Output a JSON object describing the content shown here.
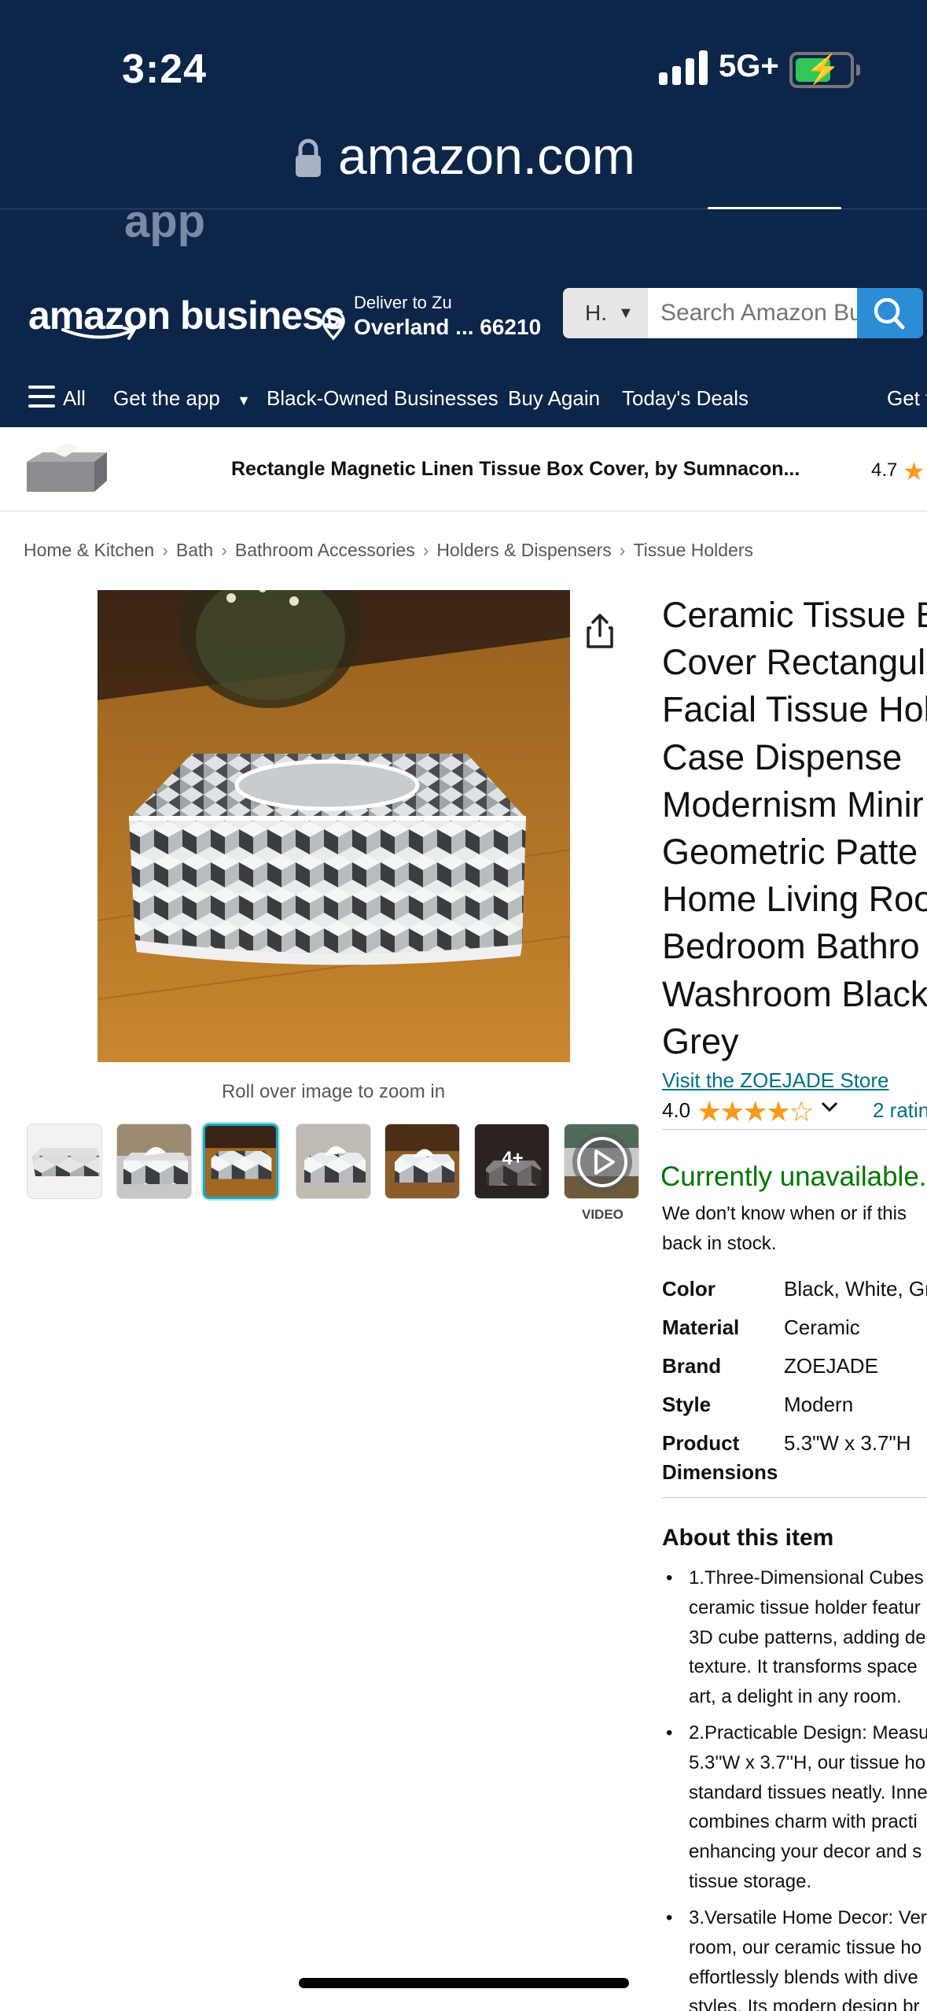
{
  "status_bar": {
    "time": "3:24",
    "network": "5G+"
  },
  "browser": {
    "url": "amazon.com",
    "banner_text": "app"
  },
  "header": {
    "logo": "amazon business",
    "deliver_line1": "Deliver to Zu",
    "deliver_line2": "Overland ... 66210",
    "search": {
      "department": "H.",
      "placeholder": "Search Amazon Business"
    }
  },
  "nav": {
    "items": [
      "All",
      "Get the app",
      "Black-Owned Businesses",
      "Buy Again",
      "Today's Deals",
      "Get f"
    ]
  },
  "sticky_bar": {
    "title": "Rectangle Magnetic Linen Tissue Box Cover, by Sumnacon...",
    "rating": "4.7"
  },
  "breadcrumb": [
    "Home & Kitchen",
    "Bath",
    "Bathroom Accessories",
    "Holders & Dispensers",
    "Tissue Holders"
  ],
  "gallery": {
    "zoom_hint": "Roll over image to zoom in",
    "more_label": "4+",
    "video_label": "VIDEO"
  },
  "product": {
    "title_lines": [
      "Ceramic Tissue B",
      "Cover Rectangula",
      "Facial Tissue Hol",
      "Case Dispense",
      "Modernism Minir",
      "Geometric Patte",
      "Home Living Roo",
      "Bedroom Bathro",
      "Washroom Black",
      "Grey"
    ],
    "store_link": "Visit the ZOEJADE Store",
    "rating": "4.0",
    "rating_value": 4.0,
    "rating_count": "2 ratin",
    "availability": "Currently unavailable.",
    "availability_desc": "We don't know when or if this back in stock.",
    "specs": [
      {
        "key": "Color",
        "value": "Black, White, Gr"
      },
      {
        "key": "Material",
        "value": "Ceramic"
      },
      {
        "key": "Brand",
        "value": "ZOEJADE"
      },
      {
        "key": "Style",
        "value": "Modern"
      },
      {
        "key": "Product Dimensions",
        "value": "5.3\"W x 3.7\"H"
      }
    ],
    "about_heading": "About this item",
    "bullets": [
      "1.Three-Dimensional Cubes\nceramic tissue holder featur\n3D cube patterns, adding de\ntexture. It transforms space\nart, a delight in any room.",
      "2.Practicable Design: Measu\n5.3''W x 3.7''H, our tissue ho\nstandard tissues neatly. Inne\ncombines charm with practi\nenhancing your decor and s\ntissue storage.",
      "3.Versatile Home Decor: Ver\nroom, our ceramic tissue ho\neffortlessly blends with dive\nstyles. Its modern design br"
    ]
  },
  "colors": {
    "header_bg": "#0c2549",
    "search_button": "#2a8dd6",
    "link": "#007185",
    "unavailable": "#007600",
    "star": "#f79a1b"
  }
}
